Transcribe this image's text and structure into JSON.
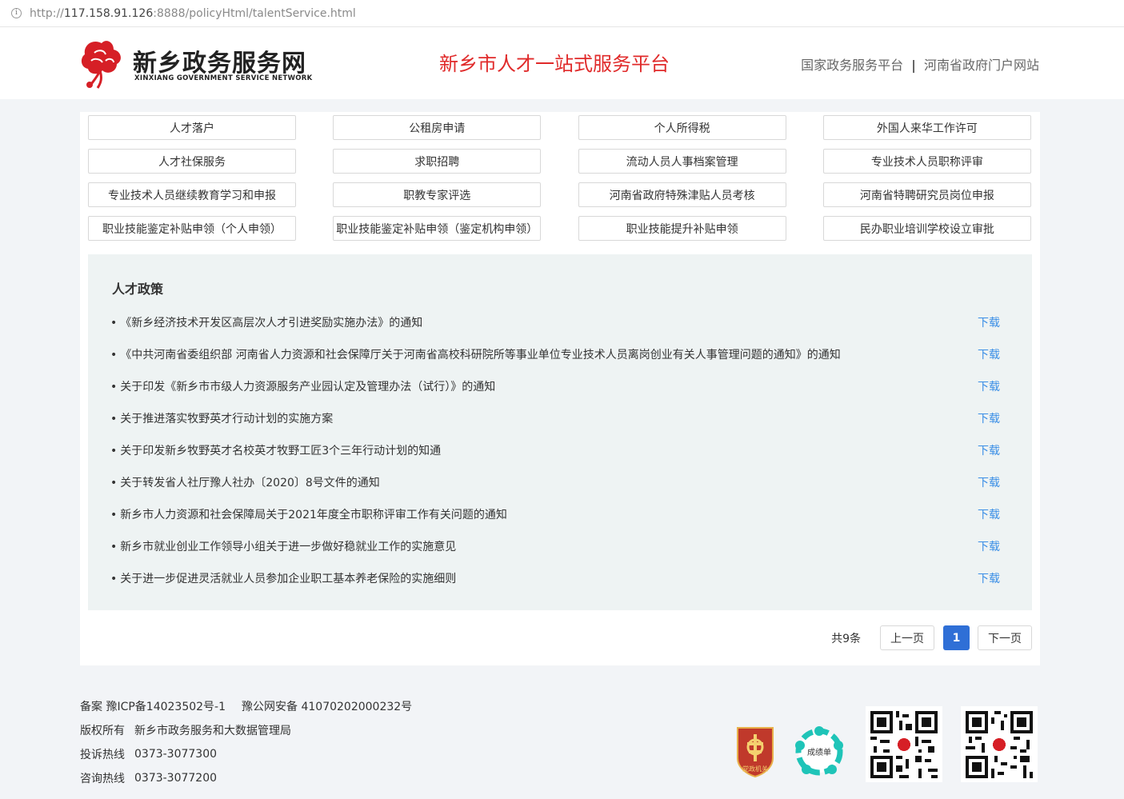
{
  "browser": {
    "url_scheme": "http://",
    "url_host": "117.158.91.126",
    "url_rest": ":8888/policyHtml/talentService.html"
  },
  "header": {
    "logo_title": "新乡政务服务网",
    "logo_subtitle": "XINXIANG GOVERNMENT SERVICE NETWORK",
    "platform_title": "新乡市人才一站式服务平台",
    "links": [
      "国家政务服务平台",
      "河南省政府门户网站"
    ],
    "link_separator": "|"
  },
  "services": [
    "人才落户",
    "公租房申请",
    "个人所得税",
    "外国人来华工作许可",
    "人才社保服务",
    "求职招聘",
    "流动人员人事档案管理",
    "专业技术人员职称评审",
    "专业技术人员继续教育学习和申报",
    "职教专家评选",
    "河南省政府特殊津贴人员考核",
    "河南省特聘研究员岗位申报",
    "职业技能鉴定补贴申领（个人申领）",
    "职业技能鉴定补贴申领（鉴定机构申领）",
    "职业技能提升补贴申领",
    "民办职业培训学校设立审批"
  ],
  "policy": {
    "title": "人才政策",
    "bullet": "•",
    "download_label": "下载",
    "items": [
      "《新乡经济技术开发区高层次人才引进奖励实施办法》的通知",
      "《中共河南省委组织部 河南省人力资源和社会保障厅关于河南省高校科研院所等事业单位专业技术人员离岗创业有关人事管理问题的通知》的通知",
      "关于印发《新乡市市级人力资源服务产业园认定及管理办法（试行）》的通知",
      "关于推进落实牧野英才行动计划的实施方案",
      "关于印发新乡牧野英才名校英才牧野工匠3个三年行动计划的知通",
      "关于转发省人社厅豫人社办〔2020〕8号文件的通知",
      "新乡市人力资源和社会保障局关于2021年度全市职称评审工作有关问题的通知",
      "新乡市就业创业工作领导小组关于进一步做好稳就业工作的实施意见",
      "关于进一步促进灵活就业人员参加企业职工基本养老保险的实施细则"
    ]
  },
  "pagination": {
    "total": "共9条",
    "prev": "上一页",
    "current": "1",
    "next": "下一页"
  },
  "footer": {
    "icp_label": "备案",
    "icp": "豫ICP备14023502号-1",
    "police": "豫公网安备 41070202000232号",
    "copyright_label": "版权所有",
    "copyright": "新乡市政务服务和大数据管理局",
    "complaint_label": "投诉热线",
    "complaint": "0373-3077300",
    "consult_label": "咨询热线",
    "consult": "0373-3077200",
    "badge1_text": "党政机关",
    "badge2_text": "成绩单"
  },
  "colors": {
    "brand_red": "#e02a2a",
    "link_blue": "#3a8ee6",
    "pager_active": "#2f6fd6",
    "policy_bg": "#eef3f3"
  }
}
